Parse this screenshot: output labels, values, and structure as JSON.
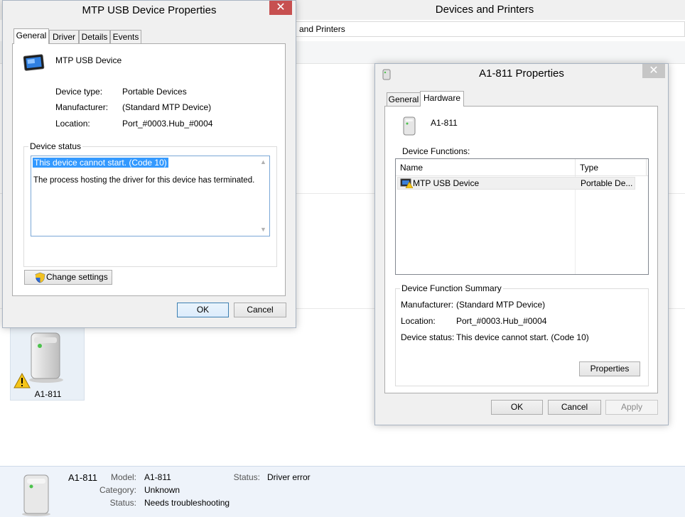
{
  "background_window": {
    "title": "Devices and Printers",
    "address": "and Printers",
    "device_tile": {
      "label": "A1-811"
    },
    "details_pane": {
      "device_name": "A1-811",
      "model_key": "Model:",
      "model_value": "A1-811",
      "category_key": "Category:",
      "category_value": "Unknown",
      "status_key": "Status:",
      "status_value": "Needs troubleshooting",
      "status2_key": "Status:",
      "status2_value": "Driver error"
    }
  },
  "mtp_dialog": {
    "title": "MTP USB Device Properties",
    "close_glyph": "✕",
    "tabs": [
      {
        "label": "General",
        "active": true
      },
      {
        "label": "Driver"
      },
      {
        "label": "Details"
      },
      {
        "label": "Events"
      }
    ],
    "device_name": "MTP USB Device",
    "properties": [
      {
        "key": "Device type:",
        "value": "Portable Devices"
      },
      {
        "key": "Manufacturer:",
        "value": "(Standard MTP Device)"
      },
      {
        "key": "Location:",
        "value": "Port_#0003.Hub_#0004"
      }
    ],
    "status_group_label": "Device status",
    "status_line1": "This device cannot start. (Code 10)",
    "status_line2": "The process hosting the driver for this device has terminated.",
    "change_settings_label": "Change settings",
    "ok_label": "OK",
    "cancel_label": "Cancel"
  },
  "a1_dialog": {
    "title": "A1-811 Properties",
    "close_glyph": "✕",
    "tabs": [
      {
        "label": "General"
      },
      {
        "label": "Hardware",
        "active": true
      }
    ],
    "device_name": "A1-811",
    "functions_label": "Device Functions:",
    "columns": [
      "Name",
      "Type"
    ],
    "rows": [
      {
        "name": "MTP USB Device",
        "type": "Portable De..."
      }
    ],
    "summary_label": "Device Function Summary",
    "summary": [
      {
        "key": "Manufacturer:",
        "value": "(Standard MTP Device)"
      },
      {
        "key": "Location:",
        "value": "Port_#0003.Hub_#0004"
      },
      {
        "key": "Device status:",
        "value": "This device cannot start. (Code 10)"
      }
    ],
    "properties_label": "Properties",
    "ok_label": "OK",
    "cancel_label": "Cancel",
    "apply_label": "Apply"
  }
}
